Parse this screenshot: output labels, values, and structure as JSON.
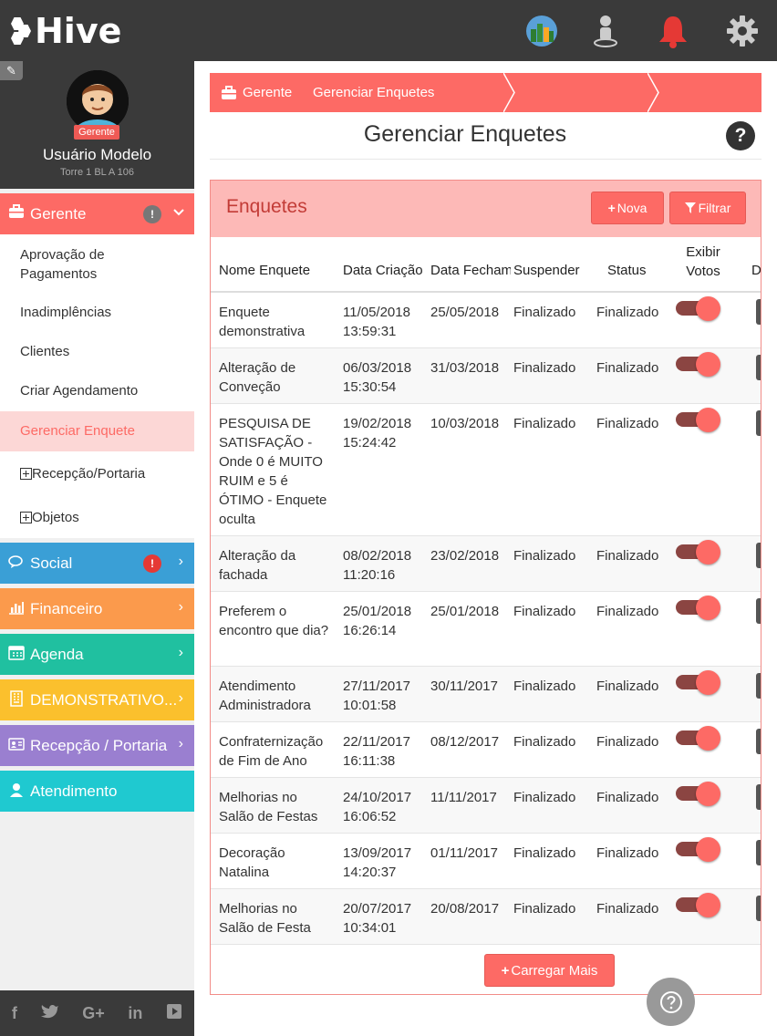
{
  "app": {
    "logo_text": "Hive"
  },
  "topbar": {
    "icons": [
      "city-icon",
      "user-location-icon",
      "bell-icon",
      "gear-icon"
    ]
  },
  "profile": {
    "role": "Gerente",
    "name": "Usuário Modelo",
    "unit": "Torre 1 BL A 106"
  },
  "sidebar": {
    "gerente": {
      "label": "Gerente",
      "badge": "!"
    },
    "sub_items": [
      {
        "label": "Aprovação de Pagamentos"
      },
      {
        "label": "Inadimplências"
      },
      {
        "label": "Clientes"
      },
      {
        "label": "Criar Agendamento"
      },
      {
        "label": "Gerenciar Enquete"
      },
      {
        "label": "Recepção/Portaria"
      },
      {
        "label": "Objetos"
      }
    ],
    "sections": [
      {
        "label": "Social",
        "badge": "!",
        "color": "#3a9fd6"
      },
      {
        "label": "Financeiro",
        "color": "#fb9a4c"
      },
      {
        "label": "Agenda",
        "color": "#20c0a0"
      },
      {
        "label": "DEMONSTRATIVO...",
        "color": "#fbc02d"
      },
      {
        "label": "Recepção / Portaria",
        "color": "#9a7fd0"
      },
      {
        "label": "Atendimento",
        "color": "#1fc9d0"
      }
    ],
    "social_links": [
      "f",
      "t",
      "G+",
      "in",
      "yt"
    ]
  },
  "breadcrumb": {
    "home": "Gerente",
    "current": "Gerenciar Enquetes"
  },
  "page": {
    "title": "Gerenciar Enquetes"
  },
  "panel": {
    "title": "Enquetes",
    "new_label": "Nova",
    "filter_label": "Filtrar",
    "load_more_label": "Carregar Mais"
  },
  "table": {
    "columns": [
      "Nome Enquete",
      "Data Criação",
      "Data Fechamento",
      "Suspender",
      "Status",
      "Exibir Votos",
      "De"
    ],
    "rows": [
      {
        "name": "Enquete demonstrativa",
        "created": "11/05/2018 13:59:31",
        "closed": "25/05/2018",
        "suspend": "Finalizado",
        "status": "Finalizado",
        "show_votes": true
      },
      {
        "name": "Alteração de Conveção",
        "created": "06/03/2018 15:30:54",
        "closed": "31/03/2018",
        "suspend": "Finalizado",
        "status": "Finalizado",
        "show_votes": true
      },
      {
        "name": "PESQUISA DE SATISFAÇÃO - Onde 0 é MUITO RUIM e 5 é ÓTIMO - Enquete oculta",
        "created": "19/02/2018 15:24:42",
        "closed": "10/03/2018",
        "suspend": "Finalizado",
        "status": "Finalizado",
        "show_votes": true
      },
      {
        "name": "Alteração da fachada",
        "created": "08/02/2018 11:20:16",
        "closed": "23/02/2018",
        "suspend": "Finalizado",
        "status": "Finalizado",
        "show_votes": true
      },
      {
        "name": "Preferem o encontro que dia?",
        "created": "25/01/2018 16:26:14",
        "closed": "25/01/2018",
        "suspend": "Finalizado",
        "status": "Finalizado",
        "show_votes": true
      },
      {
        "name": "Atendimento Administradora",
        "created": "27/11/2017 10:01:58",
        "closed": "30/11/2017",
        "suspend": "Finalizado",
        "status": "Finalizado",
        "show_votes": true
      },
      {
        "name": "Confraternização de Fim de Ano",
        "created": "22/11/2017 16:11:38",
        "closed": "08/12/2017",
        "suspend": "Finalizado",
        "status": "Finalizado",
        "show_votes": true
      },
      {
        "name": "Melhorias no Salão de Festas",
        "created": "24/10/2017 16:06:52",
        "closed": "11/11/2017",
        "suspend": "Finalizado",
        "status": "Finalizado",
        "show_votes": true
      },
      {
        "name": "Decoração Natalina",
        "created": "13/09/2017 14:20:37",
        "closed": "01/11/2017",
        "suspend": "Finalizado",
        "status": "Finalizado",
        "show_votes": true
      },
      {
        "name": "Melhorias no Salão de Festa",
        "created": "20/07/2017 10:34:01",
        "closed": "20/08/2017",
        "suspend": "Finalizado",
        "status": "Finalizado",
        "show_votes": true
      }
    ]
  }
}
